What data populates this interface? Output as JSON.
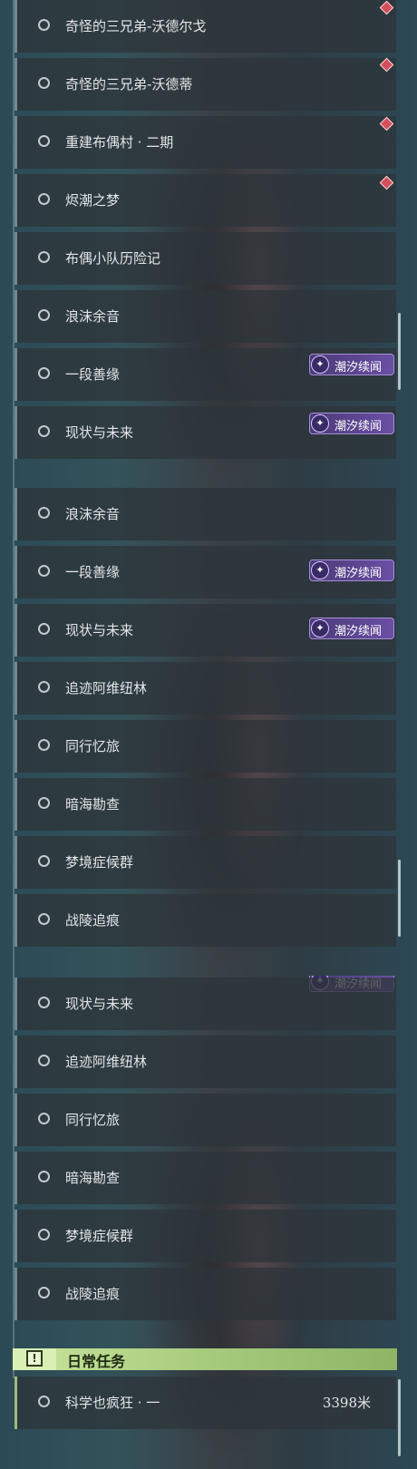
{
  "quests_page1": [
    {
      "label": "奇怪的三兄弟-沃德尔戈"
    },
    {
      "label": "奇怪的三兄弟-沃德蒂"
    },
    {
      "label": "重建布偶村 · 二期"
    },
    {
      "label": "烬潮之梦"
    },
    {
      "label": "布偶小队历险记"
    },
    {
      "label": "浪沫余音"
    },
    {
      "label": "一段善缘"
    },
    {
      "label": "现状与未来"
    }
  ],
  "quests_page2": [
    {
      "label": "浪沫余音"
    },
    {
      "label": "一段善缘"
    },
    {
      "label": "现状与未来"
    },
    {
      "label": "追迹阿维纽林"
    },
    {
      "label": "同行忆旅"
    },
    {
      "label": "暗海勘查"
    },
    {
      "label": "梦境症候群"
    },
    {
      "label": "战陵追痕"
    }
  ],
  "quests_page3": [
    {
      "label": "现状与未来"
    },
    {
      "label": "追迹阿维纽林"
    },
    {
      "label": "同行忆旅"
    },
    {
      "label": "暗海勘查"
    },
    {
      "label": "梦境症候群"
    },
    {
      "label": "战陵追痕"
    }
  ],
  "badge_text": "潮汐续闻",
  "daily": {
    "header": "日常任务",
    "quest_label": "科学也疯狂 · 一",
    "distance": "3398米"
  },
  "colors": {
    "badge": "#5b4490",
    "marker": "#d24f5c",
    "section_header": "#b6d68a"
  },
  "icons": {
    "radio": "radio-circle-icon",
    "badge": "tide-sparkle-icon",
    "marker": "diamond-marker-icon",
    "section": "exclamation-icon"
  }
}
